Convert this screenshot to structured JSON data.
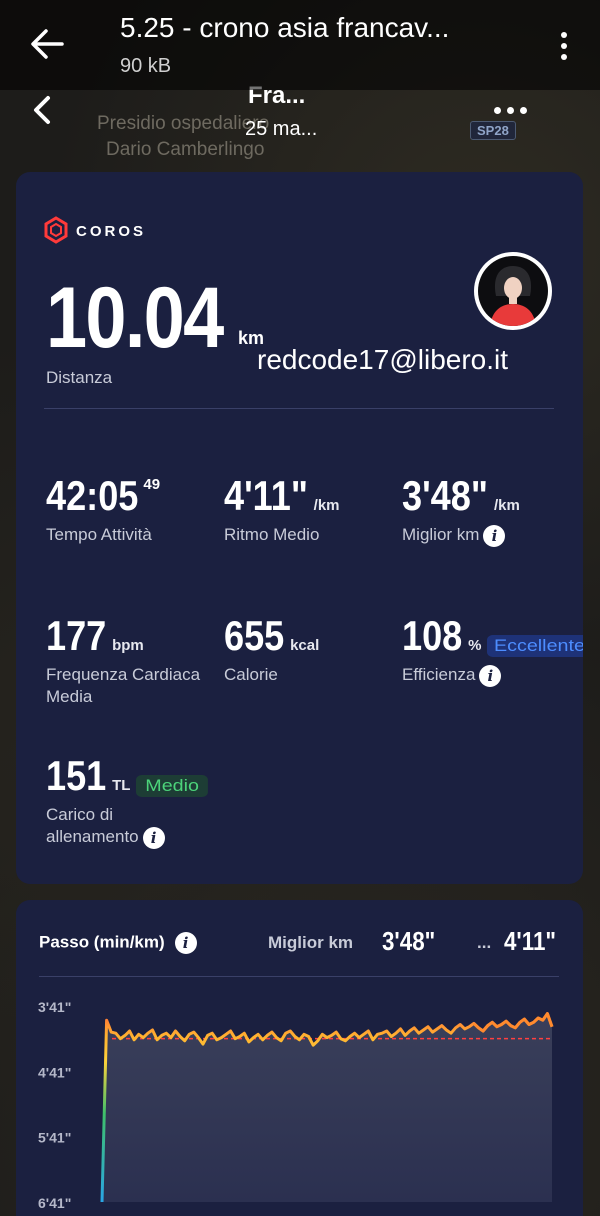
{
  "viewer": {
    "title": "5.25 - crono asia francav...",
    "size": "90 kB"
  },
  "map": {
    "labels": [
      "Presidio ospedaliero",
      "Dario Camberlingo"
    ],
    "road": "SP28"
  },
  "app": {
    "title": "Fra...",
    "date": "25 ma..."
  },
  "summary": {
    "brand": "COROS",
    "distance_value": "10.04",
    "distance_unit": "km",
    "distance_label": "Distanza",
    "user_email": "redcode17@libero.it"
  },
  "stats": {
    "time": {
      "value": "42:05",
      "sup": "49",
      "label": "Tempo Attività"
    },
    "avg_pace": {
      "value": "4'11\"",
      "unit": "/km",
      "label": "Ritmo Medio"
    },
    "best_km": {
      "value": "3'48\"",
      "unit": "/km",
      "label": "Miglior km"
    },
    "heart_rate": {
      "value": "177",
      "unit": "bpm",
      "label": "Frequenza Cardiaca Media"
    },
    "calories": {
      "value": "655",
      "unit": "kcal",
      "label": "Calorie"
    },
    "efficiency": {
      "value": "108",
      "unit": "%",
      "badge": "Eccellente",
      "label": "Efficienza"
    },
    "training_load": {
      "value": "151",
      "unit": "TL",
      "badge": "Medio",
      "label": "Carico di allenamento"
    }
  },
  "chart_section": {
    "title": "Passo (min/km)",
    "best_label": "Miglior km",
    "best_value": "3'48\"",
    "avg_label": "...",
    "avg_value": "4'11\""
  },
  "colors": {
    "card": "#1b2040",
    "accent_orange": "#ff9a2e",
    "accent_yellow": "#ffd23a",
    "badge_green": "#4cd37a",
    "badge_blue": "#4d8dff"
  },
  "chart_data": {
    "type": "area",
    "title": "Passo (min/km)",
    "ylabel": "",
    "y_tick_labels": [
      "3'41\"",
      "4'41\"",
      "5'41\"",
      "6'41\""
    ],
    "y_reversed": true,
    "ylim_seconds": [
      221,
      401
    ],
    "average_line_seconds": 251,
    "x_start": 0,
    "x_end": 10.04,
    "x_unit": "km",
    "pace_seconds": [
      401,
      234,
      245,
      246,
      251,
      248,
      244,
      252,
      247,
      250,
      246,
      243,
      252,
      248,
      246,
      250,
      244,
      249,
      253,
      247,
      245,
      250,
      256,
      248,
      246,
      252,
      250,
      247,
      244,
      251,
      249,
      246,
      254,
      250,
      247,
      252,
      248,
      245,
      250,
      253,
      246,
      244,
      249,
      252,
      247,
      249,
      257,
      253,
      247,
      250,
      248,
      245,
      251,
      253,
      249,
      246,
      250,
      247,
      244,
      252,
      247,
      246,
      244,
      249,
      246,
      242,
      248,
      244,
      241,
      246,
      243,
      240,
      245,
      242,
      239,
      243,
      246,
      241,
      238,
      242,
      240,
      237,
      241,
      244,
      239,
      236,
      240,
      238,
      235,
      239,
      241,
      236,
      233,
      238,
      236,
      232,
      234,
      228,
      240
    ]
  }
}
